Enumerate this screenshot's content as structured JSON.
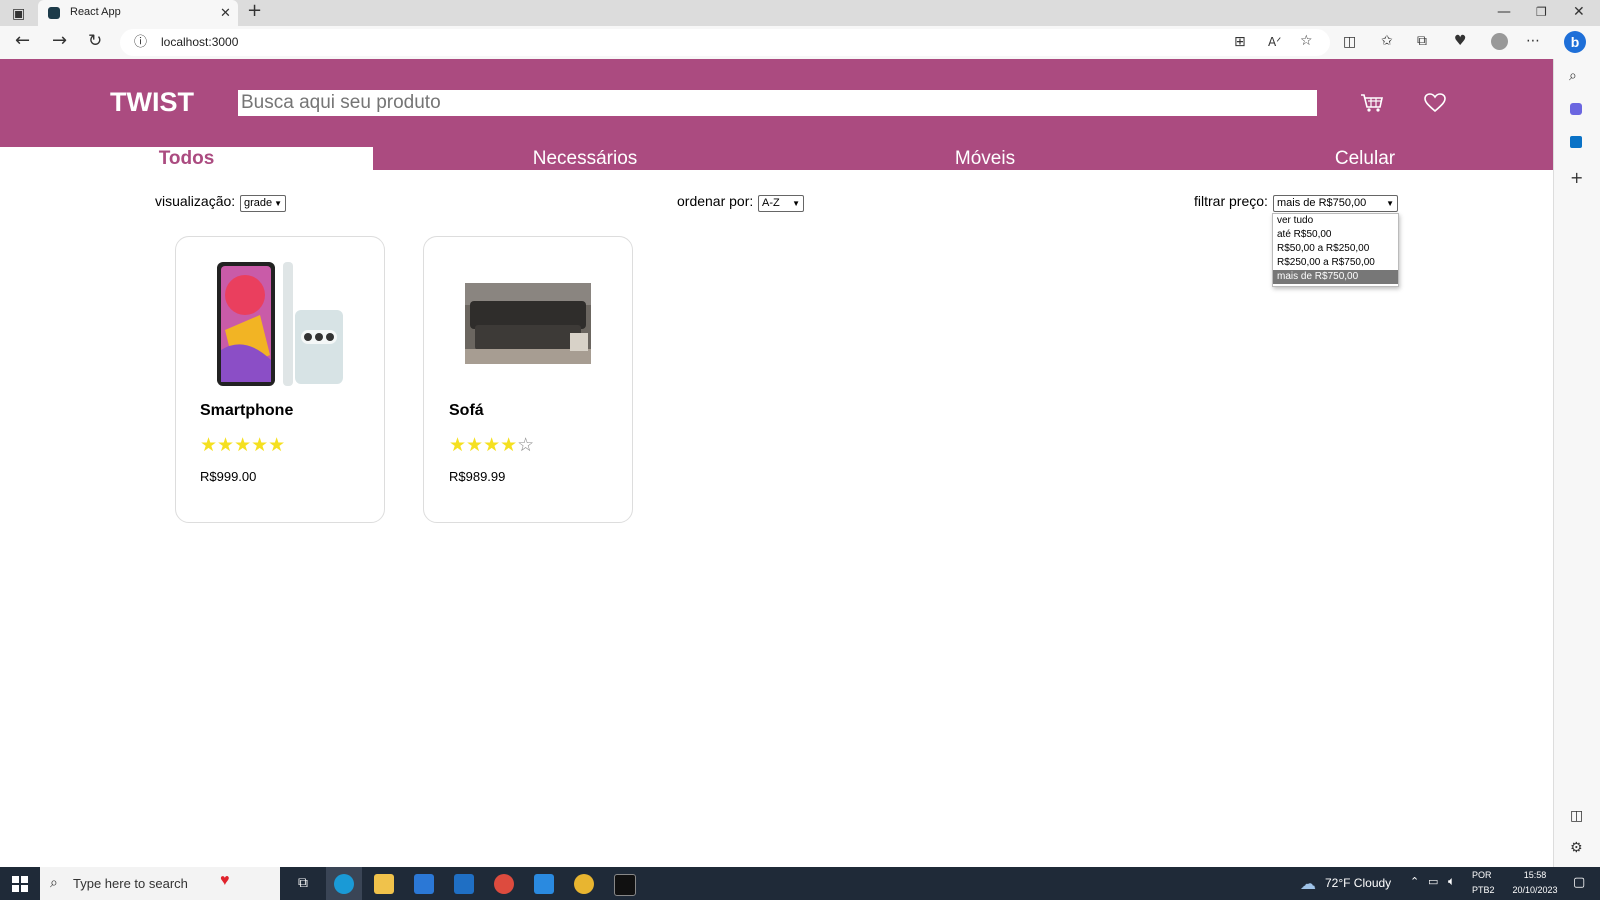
{
  "browser": {
    "tab_title": "React App",
    "new_tab": "+",
    "url": "localhost:3000",
    "window_controls": [
      "—",
      "❐",
      "✕"
    ]
  },
  "app": {
    "logo": "TWIST",
    "search_placeholder": "Busca aqui seu produto",
    "icons": [
      "cart-icon",
      "heart-icon"
    ],
    "colors": {
      "brand": "#ab4b80",
      "star": "#f5e020"
    },
    "nav": [
      {
        "label": "Todos",
        "active": true
      },
      {
        "label": "Necessários",
        "active": false
      },
      {
        "label": "Móveis",
        "active": false
      },
      {
        "label": "Celular",
        "active": false
      }
    ],
    "controls": {
      "view_label": "visualização:",
      "view_value": "grade",
      "sort_label": "ordenar por:",
      "sort_value": "A-Z",
      "price_label": "filtrar preço:",
      "price_value": "mais de R$750,00",
      "price_options": [
        "ver tudo",
        "até R$50,00",
        "R$50,00 a R$250,00",
        "R$250,00 a R$750,00",
        "mais de R$750,00"
      ],
      "price_selected_index": 4
    },
    "products": [
      {
        "name": "Smartphone",
        "rating": 5,
        "max_rating": 5,
        "price": "R$999.00"
      },
      {
        "name": "Sofá",
        "rating": 4,
        "max_rating": 5,
        "price": "R$989.99"
      }
    ]
  },
  "taskbar": {
    "search_placeholder": "Type here to search",
    "weather": "72°F  Cloudy",
    "lang_top": "POR",
    "lang_bottom": "PTB2",
    "time": "15:58",
    "date": "20/10/2023"
  }
}
